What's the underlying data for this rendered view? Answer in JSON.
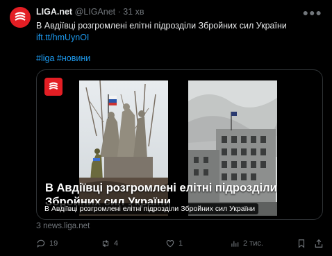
{
  "author": {
    "name": "LIGA.net",
    "handle": "@LIGAnet",
    "separator": "·",
    "time": "31 хв"
  },
  "tweet": {
    "text": "В Авдіївці розгромлені елітні підрозділи Збройних сил України",
    "link": "ift.tt/hmUynOI",
    "hashtags": "#liga #новини"
  },
  "card": {
    "title": "В Авдіївці розгромлені елітні підрозділи Збройних сил України",
    "caption": "В Авдіївці розгромлені елітні підрозділи Збройних сил України",
    "source": "З news.liga.net"
  },
  "actions": {
    "reply_count": "19",
    "retweet_count": "4",
    "like_count": "1",
    "views_count": "2 тис."
  },
  "colors": {
    "brand": "#e31e24",
    "link": "#1d9bf0",
    "muted": "#71767b"
  },
  "icons": [
    "liga-logo-icon",
    "more-icon",
    "reply-icon",
    "retweet-icon",
    "like-icon",
    "views-icon",
    "bookmark-icon",
    "share-icon"
  ]
}
